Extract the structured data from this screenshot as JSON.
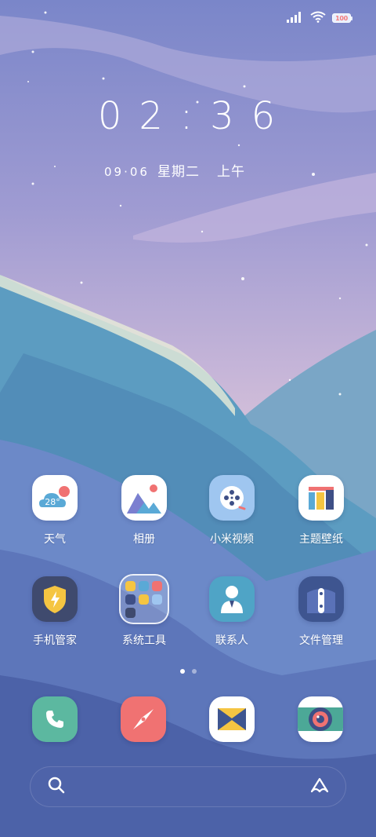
{
  "status_bar": {
    "signal_icon": "signal-bars-icon",
    "wifi_icon": "wifi-icon",
    "battery_level": "100",
    "battery_color": "#f47b7b"
  },
  "lockclock": {
    "time": "02:36",
    "date": "09·06",
    "weekday": "星期二",
    "ampm": "上午"
  },
  "apps": [
    {
      "label": "天气",
      "icon": "weather-icon",
      "temp": "28°"
    },
    {
      "label": "相册",
      "icon": "gallery-icon"
    },
    {
      "label": "小米视频",
      "icon": "video-reel-icon"
    },
    {
      "label": "主题壁纸",
      "icon": "theme-icon"
    },
    {
      "label": "手机管家",
      "icon": "security-shield-icon"
    },
    {
      "label": "系统工具",
      "icon": "folder-icon"
    },
    {
      "label": "联系人",
      "icon": "contacts-icon"
    },
    {
      "label": "文件管理",
      "icon": "file-manager-icon"
    }
  ],
  "pages": {
    "count": 2,
    "active": 1
  },
  "dock": [
    {
      "icon": "phone-icon"
    },
    {
      "icon": "browser-compass-icon"
    },
    {
      "icon": "messages-icon"
    },
    {
      "icon": "camera-icon"
    }
  ],
  "search": {
    "search_icon": "search-icon",
    "assistant_icon": "assistant-icon"
  },
  "colors": {
    "phone": "#5cb8a0",
    "browser": "#f07272",
    "camera_band": "#4ca897",
    "security": "#3f4a6e",
    "file_manager": "#3e5590"
  }
}
